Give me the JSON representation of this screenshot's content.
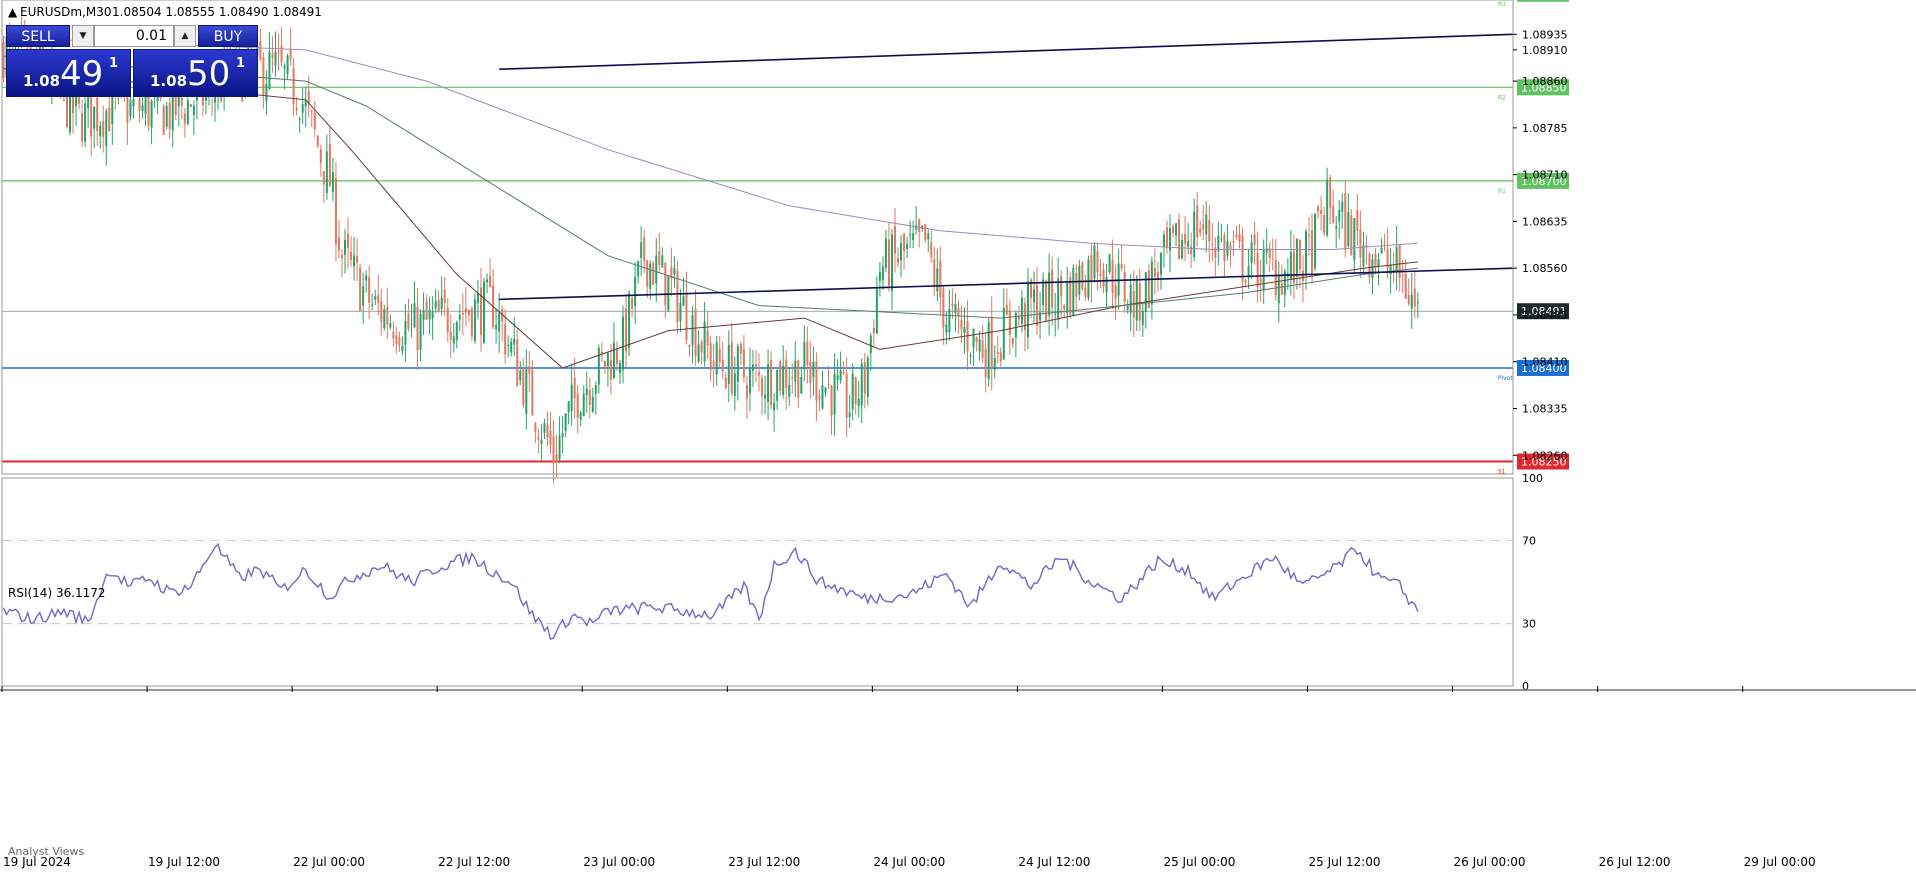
{
  "header": {
    "symbol": "EURUSDm,M30",
    "ohlc": "1.08504 1.08555 1.08490 1.08491"
  },
  "trade_panel": {
    "sell_label": "SELL",
    "buy_label": "BUY",
    "lot": "0.01",
    "bid": {
      "prefix": "1.08",
      "big": "49",
      "sup": "1"
    },
    "ask": {
      "prefix": "1.08",
      "big": "50",
      "sup": "1"
    }
  },
  "indicator_label": "RSI(14) 36.1172",
  "bottom_tab": "Analyst Views",
  "colors": {
    "bull": "#26a269",
    "bear": "#e07862",
    "pivot": "#1a6fd4",
    "support": "#e0272f",
    "resistance": "#5ec25e",
    "trendline": "#0c1050",
    "rsi": "#7a64c4",
    "ma_fast": "#6a3a3a",
    "ma_mid": "#5a7a6a",
    "ma_slow": "#a688b6",
    "current_price_bg": "#1e2a2a"
  },
  "chart_data": [
    {
      "type": "candlestick",
      "symbol": "EURUSDm",
      "timeframe": "M30",
      "ylim": [
        1.0823,
        1.0899
      ],
      "y_ticks": [
        "1.08935",
        "1.08860",
        "1.08785",
        "1.08710",
        "1.08635",
        "1.08560",
        "1.08485",
        "1.08410",
        "1.08335",
        "1.08260",
        "1.08910"
      ],
      "x_ticks": [
        "19 Jul 2024",
        "19 Jul 12:00",
        "22 Jul 00:00",
        "22 Jul 12:00",
        "23 Jul 00:00",
        "23 Jul 12:00",
        "24 Jul 00:00",
        "24 Jul 12:00",
        "25 Jul 00:00",
        "25 Jul 12:00",
        "26 Jul 00:00",
        "26 Jul 12:00",
        "29 Jul 00:00"
      ],
      "close_path": [
        [
          0,
          1.0891
        ],
        [
          12,
          1.0888
        ],
        [
          25,
          1.088
        ],
        [
          40,
          1.0882
        ],
        [
          55,
          1.0881
        ],
        [
          68,
          1.0884
        ],
        [
          76,
          1.0887
        ],
        [
          90,
          1.0888
        ],
        [
          98,
          1.0884
        ],
        [
          108,
          1.087
        ],
        [
          112,
          1.0858
        ],
        [
          122,
          1.085
        ],
        [
          135,
          1.0846
        ],
        [
          150,
          1.0849
        ],
        [
          162,
          1.085
        ],
        [
          172,
          1.0838
        ],
        [
          182,
          1.0826
        ],
        [
          190,
          1.0836
        ],
        [
          205,
          1.0844
        ],
        [
          212,
          1.0858
        ],
        [
          222,
          1.0852
        ],
        [
          235,
          1.0841
        ],
        [
          250,
          1.0838
        ],
        [
          265,
          1.084
        ],
        [
          280,
          1.0834
        ],
        [
          285,
          1.0838
        ],
        [
          290,
          1.0856
        ],
        [
          305,
          1.086
        ],
        [
          312,
          1.0848
        ],
        [
          325,
          1.0843
        ],
        [
          340,
          1.085
        ],
        [
          352,
          1.0852
        ],
        [
          362,
          1.0858
        ],
        [
          375,
          1.085
        ],
        [
          382,
          1.0856
        ],
        [
          395,
          1.0863
        ],
        [
          410,
          1.0857
        ],
        [
          425,
          1.0855
        ],
        [
          432,
          1.0858
        ],
        [
          438,
          1.0866
        ],
        [
          445,
          1.0862
        ],
        [
          452,
          1.0859
        ],
        [
          462,
          1.0855
        ],
        [
          468,
          1.0849
        ]
      ],
      "moving_averages": [
        {
          "name": "MA fast",
          "values": [
            [
              0,
              1.0888
            ],
            [
              100,
              1.0883
            ],
            [
              115,
              1.0875
            ],
            [
              150,
              1.0855
            ],
            [
              185,
              1.084
            ],
            [
              220,
              1.0846
            ],
            [
              265,
              1.0848
            ],
            [
              290,
              1.0843
            ],
            [
              330,
              1.0846
            ],
            [
              370,
              1.085
            ],
            [
              410,
              1.0853
            ],
            [
              450,
              1.0856
            ],
            [
              468,
              1.0857
            ]
          ]
        },
        {
          "name": "MA mid",
          "values": [
            [
              0,
              1.089
            ],
            [
              100,
              1.0886
            ],
            [
              120,
              1.0882
            ],
            [
              160,
              1.087
            ],
            [
              200,
              1.0858
            ],
            [
              250,
              1.085
            ],
            [
              290,
              1.0849
            ],
            [
              330,
              1.0848
            ],
            [
              370,
              1.085
            ],
            [
              410,
              1.0852
            ],
            [
              450,
              1.0855
            ],
            [
              468,
              1.0856
            ]
          ]
        },
        {
          "name": "MA slow",
          "values": [
            [
              0,
              1.0893
            ],
            [
              100,
              1.0891
            ],
            [
              140,
              1.0886
            ],
            [
              200,
              1.0875
            ],
            [
              260,
              1.0866
            ],
            [
              310,
              1.0862
            ],
            [
              360,
              1.086
            ],
            [
              400,
              1.0859
            ],
            [
              440,
              1.0859
            ],
            [
              468,
              1.086
            ]
          ]
        }
      ],
      "horizontal_levels": [
        {
          "price": 1.09,
          "label": "1.09000",
          "tag": "R3",
          "kind": "resistance"
        },
        {
          "price": 1.0885,
          "label": "1.08850",
          "tag": "R2",
          "kind": "resistance"
        },
        {
          "price": 1.087,
          "label": "1.08700",
          "tag": "R1",
          "kind": "resistance"
        },
        {
          "price": 1.08491,
          "label": "1.08491",
          "tag": "",
          "kind": "current"
        },
        {
          "price": 1.084,
          "label": "1.08400",
          "tag": "Pivot",
          "kind": "pivot"
        },
        {
          "price": 1.0825,
          "label": "1.08250",
          "tag": "S1",
          "kind": "support"
        }
      ],
      "trendlines": [
        {
          "from": [
            164,
            1.08879
          ],
          "to": [
            700,
            1.08935
          ]
        },
        {
          "from": [
            164,
            1.0851
          ],
          "to": [
            700,
            1.0856
          ]
        }
      ]
    },
    {
      "type": "line",
      "title": "RSI(14) 36.1172",
      "ylim": [
        0,
        100
      ],
      "y_ticks": [
        "100",
        "70",
        "30",
        "0"
      ],
      "levels": [
        70,
        30
      ],
      "values": [
        [
          0,
          36
        ],
        [
          10,
          32
        ],
        [
          20,
          36
        ],
        [
          28,
          31
        ],
        [
          35,
          56
        ],
        [
          42,
          48
        ],
        [
          48,
          52
        ],
        [
          55,
          45
        ],
        [
          62,
          48
        ],
        [
          70,
          68
        ],
        [
          78,
          52
        ],
        [
          85,
          56
        ],
        [
          92,
          46
        ],
        [
          100,
          56
        ],
        [
          108,
          43
        ],
        [
          115,
          52
        ],
        [
          125,
          58
        ],
        [
          135,
          50
        ],
        [
          145,
          58
        ],
        [
          155,
          62
        ],
        [
          162,
          55
        ],
        [
          168,
          50
        ],
        [
          175,
          34
        ],
        [
          182,
          24
        ],
        [
          188,
          34
        ],
        [
          195,
          30
        ],
        [
          200,
          36
        ],
        [
          215,
          38
        ],
        [
          225,
          36
        ],
        [
          235,
          34
        ],
        [
          245,
          48
        ],
        [
          250,
          32
        ],
        [
          255,
          58
        ],
        [
          262,
          65
        ],
        [
          270,
          50
        ],
        [
          278,
          46
        ],
        [
          285,
          42
        ],
        [
          300,
          44
        ],
        [
          312,
          54
        ],
        [
          320,
          38
        ],
        [
          330,
          60
        ],
        [
          340,
          48
        ],
        [
          350,
          62
        ],
        [
          360,
          50
        ],
        [
          370,
          42
        ],
        [
          382,
          60
        ],
        [
          392,
          56
        ],
        [
          400,
          42
        ],
        [
          412,
          54
        ],
        [
          420,
          62
        ],
        [
          430,
          48
        ],
        [
          440,
          56
        ],
        [
          448,
          66
        ],
        [
          455,
          52
        ],
        [
          462,
          48
        ],
        [
          468,
          36
        ]
      ]
    }
  ]
}
